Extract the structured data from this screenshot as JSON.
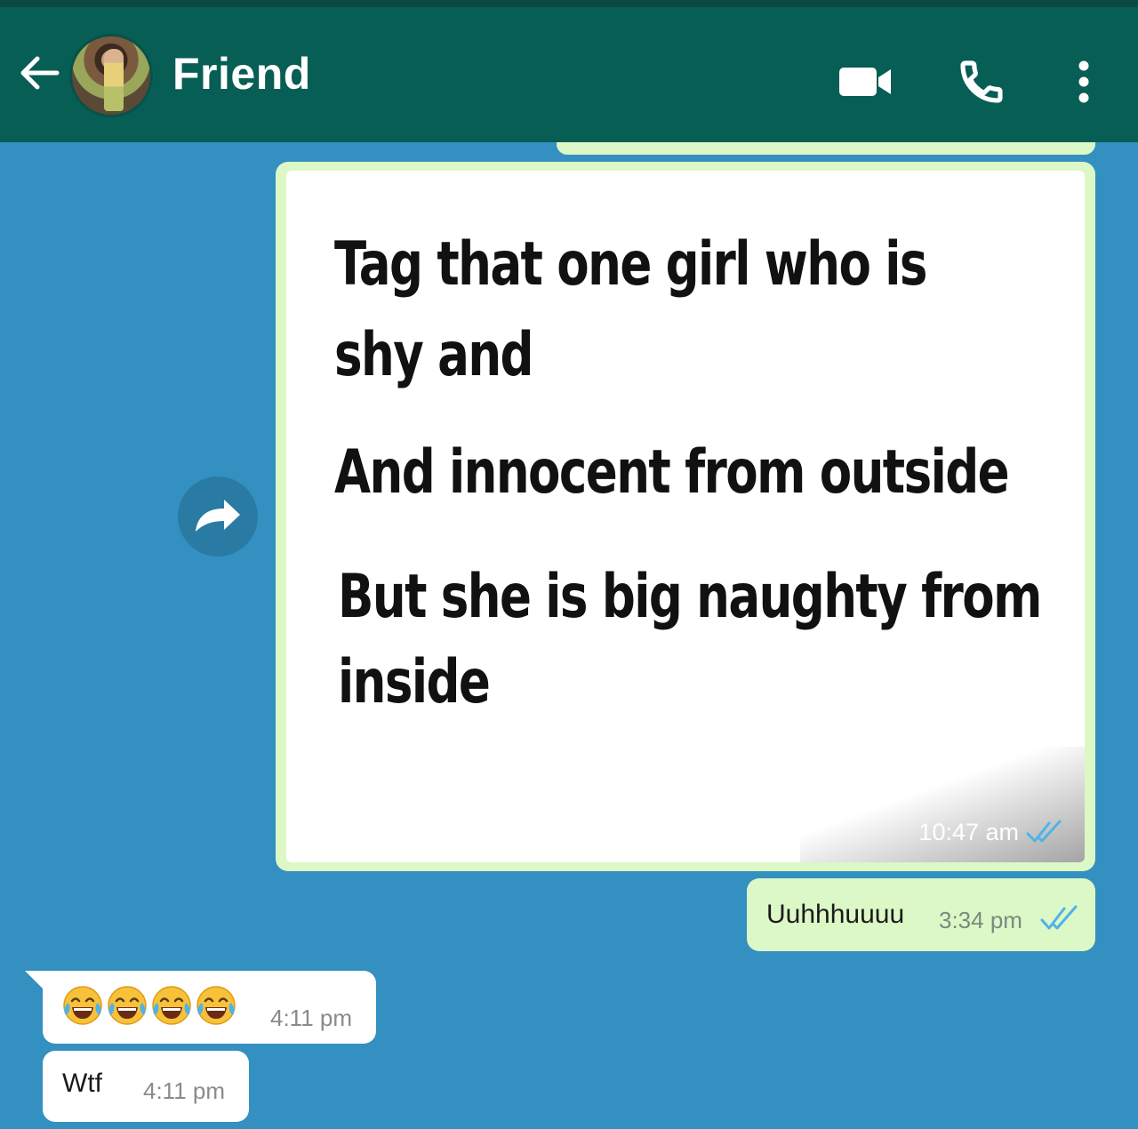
{
  "header": {
    "title": "Friend",
    "back_icon": "arrow-left-icon",
    "video_icon": "video-call-icon",
    "call_icon": "phone-icon",
    "menu_icon": "more-vert-icon",
    "bar_color": "#075e54"
  },
  "messages": {
    "image_message": {
      "lines": [
        "Tag that one girl who is",
        "shy and",
        "And innocent from outside",
        "But she is big naughty from",
        "inside"
      ],
      "time": "10:47 am",
      "status_icon": "double-check-read-icon",
      "forward_icon": "forward-icon"
    },
    "outgoing_text": {
      "text": "Uuhhhuuuu",
      "time": "3:34 pm",
      "status_icon": "double-check-read-icon"
    },
    "incoming_emoji": {
      "emojis": [
        "😂",
        "😂",
        "😂",
        "😂"
      ],
      "emoji_name": "face-with-tears-of-joy",
      "time": "4:11 pm"
    },
    "incoming_text": {
      "text": "Wtf",
      "time": "4:11 pm"
    }
  },
  "colors": {
    "chat_background": "#3390c0",
    "outgoing_bubble": "#dcf8c6",
    "incoming_bubble": "#ffffff",
    "read_tick": "#4fb3e8"
  }
}
